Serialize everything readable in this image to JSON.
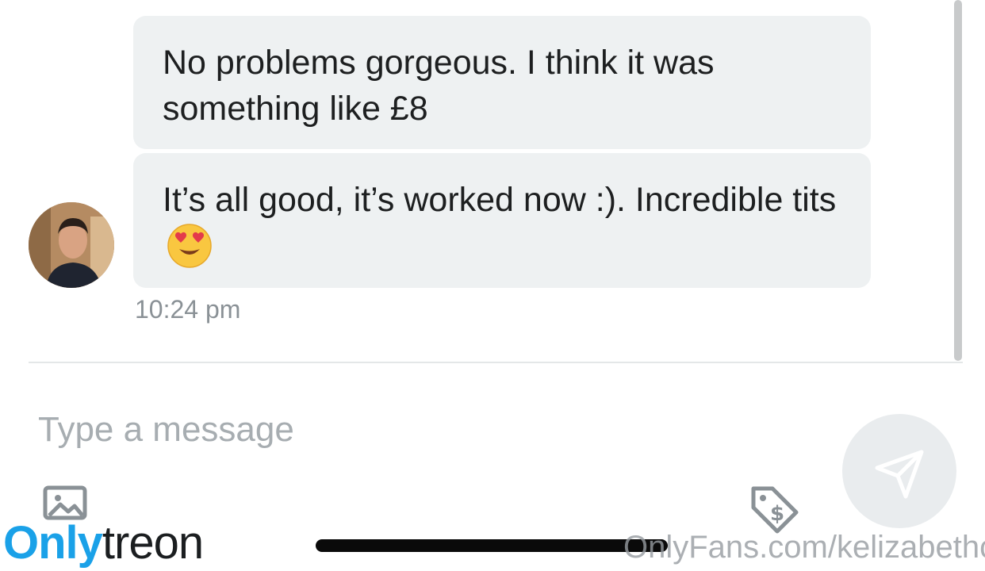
{
  "chat": {
    "messages": [
      {
        "text": "No problems gorgeous. I think it was something like £8"
      },
      {
        "text": "It’s all good, it’s worked now :). Incredible tits",
        "emoji": "heart-eyes-emoji"
      }
    ],
    "timestamp": "10:24 pm"
  },
  "composer": {
    "placeholder": "Type a message",
    "value": "",
    "icons": {
      "media": "image-icon",
      "price": "price-tag-dollar-icon",
      "send": "paper-plane-icon"
    }
  },
  "watermark": {
    "logo_part1": "Only",
    "logo_part2": "treon",
    "url": "OnlyFans.com/kelizabethc"
  },
  "colors": {
    "bubble_background": "#eef1f2",
    "logo_accent": "#1aa1e8",
    "placeholder": "#a7adb1",
    "timestamp": "#8a9196"
  }
}
